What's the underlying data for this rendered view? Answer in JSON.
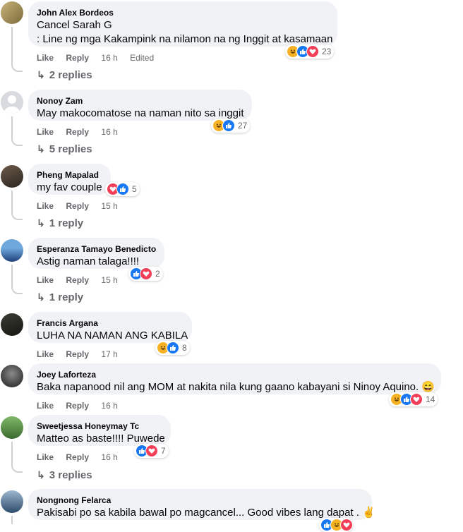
{
  "comments": [
    {
      "name": "John Alex Bordeos",
      "text_lines": [
        "Cancel Sarah G",
        ": Line ng mga Kakampink na nilamon na ng Inggit at kasamaan"
      ],
      "like": "Like",
      "reply": "Reply",
      "time": "16 h",
      "edited": "Edited",
      "reactions": [
        "haha-icon",
        "like-icon",
        "love-icon"
      ],
      "reaction_count": "23",
      "replies": "2 replies"
    },
    {
      "name": "Nonoy Zam",
      "text_lines": [
        "May makocomatose na naman nito sa inggit"
      ],
      "like": "Like",
      "reply": "Reply",
      "time": "16 h",
      "reactions": [
        "haha-icon",
        "like-icon"
      ],
      "reaction_count": "27",
      "replies": "5 replies"
    },
    {
      "name": "Pheng Mapalad",
      "text_lines": [
        "my fav couple"
      ],
      "like": "Like",
      "reply": "Reply",
      "time": "15 h",
      "reactions": [
        "love-icon",
        "like-icon"
      ],
      "reaction_count": "5",
      "replies": "1 reply"
    },
    {
      "name": "Esperanza Tamayo Benedicto",
      "text_lines": [
        "Astig naman talaga!!!!"
      ],
      "like": "Like",
      "reply": "Reply",
      "time": "15 h",
      "reactions": [
        "like-icon",
        "love-icon"
      ],
      "reaction_count": "2",
      "replies": "1 reply"
    },
    {
      "name": "Francis Argana",
      "text_lines": [
        "LUHA NA NAMAN ANG KABILA"
      ],
      "like": "Like",
      "reply": "Reply",
      "time": "17 h",
      "reactions": [
        "haha-icon",
        "like-icon"
      ],
      "reaction_count": "8"
    },
    {
      "name": "Joey Laforteza",
      "text_lines": [
        "Baka napanood nil ang MOM at nakita nila kung gaano kabayani si Ninoy Aquino. 😄"
      ],
      "like": "Like",
      "reply": "Reply",
      "time": "16 h",
      "reactions": [
        "haha-icon",
        "like-icon",
        "love-icon"
      ],
      "reaction_count": "14"
    },
    {
      "name": "Sweetjessa Honeymay Tc",
      "text_lines": [
        "Matteo as baste!!!! Puwede"
      ],
      "like": "Like",
      "reply": "Reply",
      "time": "16 h",
      "reactions": [
        "like-icon",
        "love-icon"
      ],
      "reaction_count": "7",
      "replies": "3 replies"
    },
    {
      "name": "Nongnong Felarca",
      "text_lines": [
        "Pakisabi po sa kabila bawal po magcancel... Good vibes lang dapat . ✌"
      ],
      "reactions": [
        "like-icon",
        "haha-icon",
        "love-icon"
      ]
    }
  ],
  "colors": {
    "bubble": "#f0f2f5",
    "meta": "#65676b",
    "like": "#1877f2",
    "love": "#f33e58",
    "haha": "#f7b125"
  }
}
